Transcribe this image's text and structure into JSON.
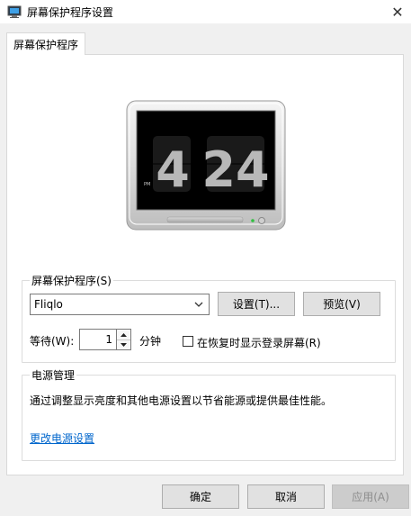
{
  "window": {
    "title": "屏幕保护程序设置",
    "close_glyph": "✕"
  },
  "tabs": [
    {
      "label": "屏幕保护程序"
    }
  ],
  "preview": {
    "clock_hour": "4",
    "clock_minute": "24",
    "clock_period": "PM"
  },
  "screensaver_group": {
    "title": "屏幕保护程序(S)",
    "selected": "Fliqlo",
    "settings_label": "设置(T)...",
    "preview_label": "预览(V)",
    "wait_label": "等待(W):",
    "wait_value": "1",
    "wait_unit": "分钟",
    "resume_checkbox_label": "在恢复时显示登录屏幕(R)",
    "resume_checked": false
  },
  "power_group": {
    "title": "电源管理",
    "description": "通过调整显示亮度和其他电源设置以节省能源或提供最佳性能。",
    "link": "更改电源设置"
  },
  "footer": {
    "ok_label": "确定",
    "cancel_label": "取消",
    "apply_label": "应用(A)"
  },
  "colors": {
    "link": "#0066cc",
    "window_bg": "#f0f0f0",
    "panel_bg": "#ffffff"
  }
}
